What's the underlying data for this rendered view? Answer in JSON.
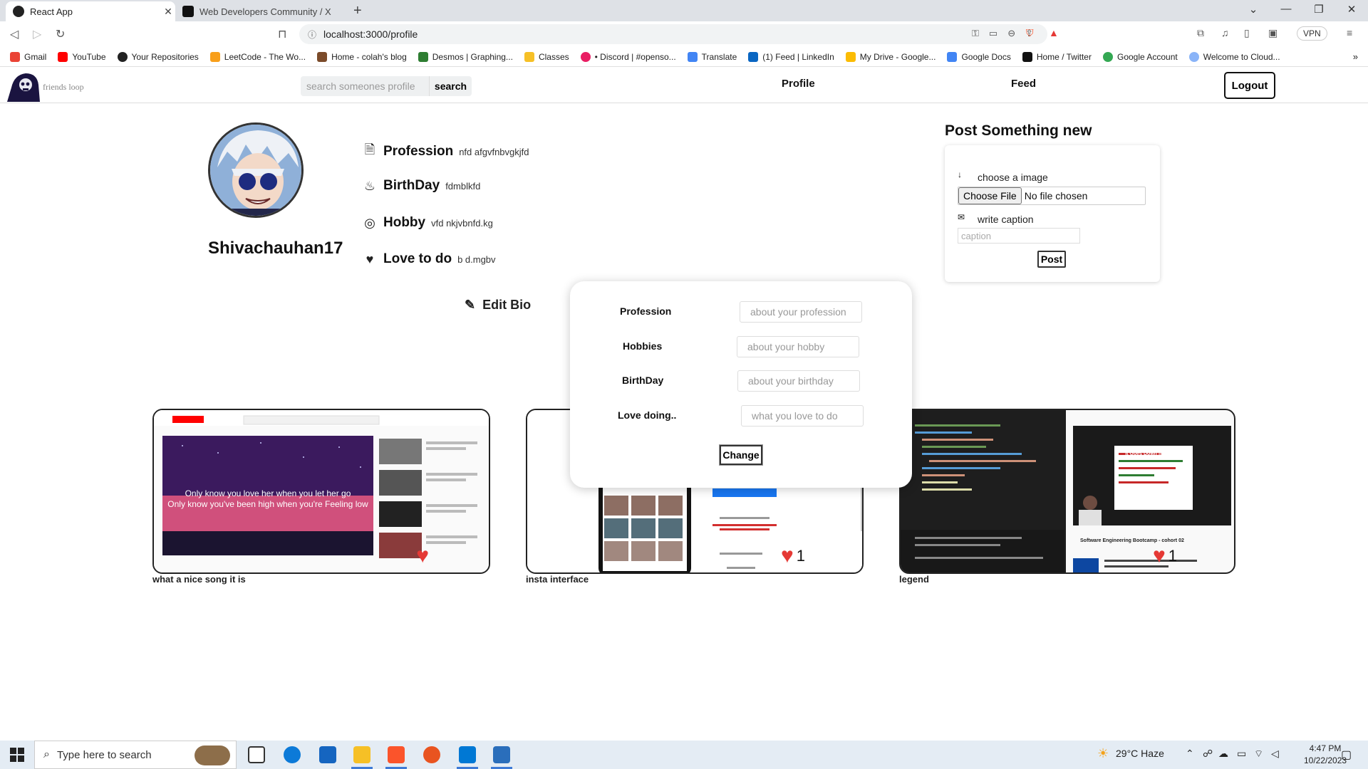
{
  "browser": {
    "tabs": [
      {
        "title": "React App",
        "active": true
      },
      {
        "title": "Web Developers Community / X",
        "active": false
      }
    ],
    "url": "localhost:3000/profile",
    "vpn_label": "VPN",
    "bookmarks": [
      "Gmail",
      "YouTube",
      "Your Repositories",
      "LeetCode - The Wo...",
      "Home - colah's blog",
      "Desmos | Graphing...",
      "Classes",
      "• Discord | #openso...",
      "Translate",
      "(1) Feed | LinkedIn",
      "My Drive - Google...",
      "Google Docs",
      "Home / Twitter",
      "Google Account",
      "Welcome to Cloud..."
    ]
  },
  "app": {
    "brand": "friends loop",
    "search_placeholder": "search someones profile",
    "search_button": "search",
    "nav_profile": "Profile",
    "nav_feed": "Feed",
    "logout": "Logout"
  },
  "profile": {
    "username": "Shivachauhan17",
    "bio": [
      {
        "label": "Profession",
        "value": "nfd afgvfnbvgkjfd",
        "icon": "document-icon"
      },
      {
        "label": "BirthDay",
        "value": "fdmblkfd",
        "icon": "cake-icon"
      },
      {
        "label": "Hobby",
        "value": "vfd nkjvbnfd.kg",
        "icon": "hobby-icon"
      },
      {
        "label": "Love to do",
        "value": "b d.mgbv",
        "icon": "heart-icon"
      }
    ],
    "edit_bio": "Edit Bio"
  },
  "new_post": {
    "title": "Post Something new",
    "image_label": "choose a image",
    "file_button": "Choose File",
    "file_status": "No file chosen",
    "caption_label": "write caption",
    "caption_placeholder": "caption",
    "post_button": "Post"
  },
  "edit_modal": {
    "fields": [
      {
        "label": "Profession",
        "placeholder": "about your profession"
      },
      {
        "label": "Hobbies",
        "placeholder": "about your hobby"
      },
      {
        "label": "BirthDay",
        "placeholder": "about your birthday"
      },
      {
        "label": "Love doing..",
        "placeholder": "what you love to do"
      }
    ],
    "change_button": "Change"
  },
  "posts": [
    {
      "caption": "what a nice song it is",
      "likes": "",
      "lyric1": "Only know you love her when you let her go",
      "lyric2": "Only know you've been high when you're Feeling low"
    },
    {
      "caption": "insta interface",
      "likes": "1"
    },
    {
      "caption": "legend",
      "likes": "1",
      "thumb_title": "It Goes Down In The DB",
      "thumb_sub": "Software Engineering Bootcamp - cohort 02"
    }
  ],
  "taskbar": {
    "search_placeholder": "Type here to search",
    "weather": "29°C  Haze",
    "time": "4:47 PM",
    "date": "10/22/2023"
  }
}
